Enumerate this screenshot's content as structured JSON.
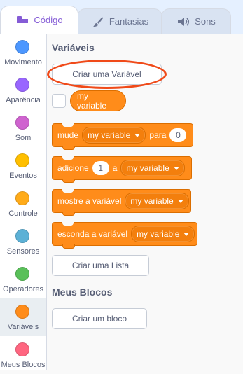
{
  "tabs": [
    {
      "label": "Código",
      "icon": "code-icon"
    },
    {
      "label": "Fantasias",
      "icon": "brush-icon"
    },
    {
      "label": "Sons",
      "icon": "speaker-icon"
    }
  ],
  "categories": [
    {
      "label": "Movimento",
      "color": "#4c97ff"
    },
    {
      "label": "Aparência",
      "color": "#9966ff"
    },
    {
      "label": "Som",
      "color": "#cf63cf"
    },
    {
      "label": "Eventos",
      "color": "#ffbf00"
    },
    {
      "label": "Controle",
      "color": "#ffab19"
    },
    {
      "label": "Sensores",
      "color": "#5cb1d6"
    },
    {
      "label": "Operadores",
      "color": "#59c059"
    },
    {
      "label": "Variáveis",
      "color": "#ff8c1a",
      "selected": true
    },
    {
      "label": "Meus Blocos",
      "color": "#ff6680"
    }
  ],
  "palette": {
    "variables_heading": "Variáveis",
    "create_variable_label": "Criar uma Variável",
    "variable_reporter": "my variable",
    "blocks": {
      "set": {
        "label": "mude",
        "dropdown": "my variable",
        "label2": "para",
        "value": "0"
      },
      "change": {
        "label": "adicione",
        "value": "1",
        "label2": "a",
        "dropdown": "my variable"
      },
      "show": {
        "label": "mostre a variável",
        "dropdown": "my variable"
      },
      "hide": {
        "label": "esconda a variável",
        "dropdown": "my variable"
      }
    },
    "create_list_label": "Criar uma Lista",
    "my_blocks_heading": "Meus Blocos",
    "create_block_label": "Criar um bloco"
  },
  "accent": "#855cd6",
  "highlight_color": "#f04a19"
}
